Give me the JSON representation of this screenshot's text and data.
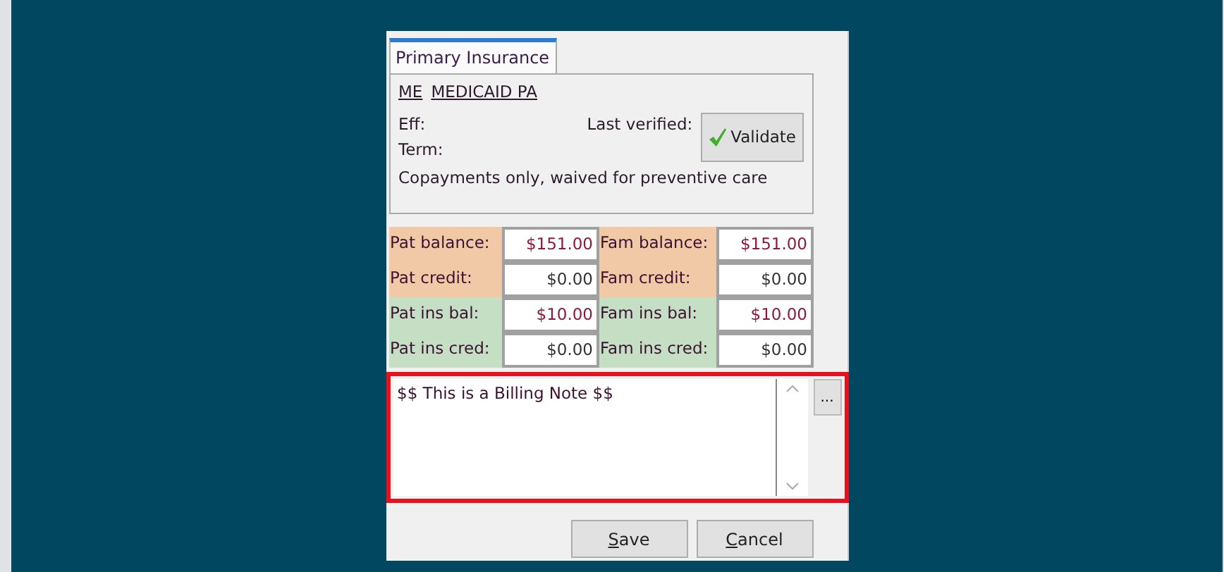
{
  "tab": {
    "label": "Primary Insurance",
    "selected": true
  },
  "plan": {
    "code": "ME",
    "name": "MEDICAID PA"
  },
  "eff_label": "Eff:",
  "term_label": "Term:",
  "last_verified_label": "Last verified:",
  "validate_button": "Validate",
  "coverage_note": "Copayments only, waived for preventive care",
  "balances": [
    {
      "label": "Pat balance:",
      "value": "$151.00",
      "color": "#8b1a3a",
      "kind": "account"
    },
    {
      "label": "Fam balance:",
      "value": "$151.00",
      "color": "#8b1a3a",
      "kind": "account"
    },
    {
      "label": "Pat credit:",
      "value": "$0.00",
      "color": "#333333",
      "kind": "account"
    },
    {
      "label": "Fam credit:",
      "value": "$0.00",
      "color": "#333333",
      "kind": "account"
    },
    {
      "label": "Pat ins bal:",
      "value": "$10.00",
      "color": "#8b1a3a",
      "kind": "insurance"
    },
    {
      "label": "Fam ins bal:",
      "value": "$10.00",
      "color": "#8b1a3a",
      "kind": "insurance"
    },
    {
      "label": "Pat ins cred:",
      "value": "$0.00",
      "color": "#333333",
      "kind": "insurance"
    },
    {
      "label": "Fam ins cred:",
      "value": "$0.00",
      "color": "#333333",
      "kind": "insurance"
    }
  ],
  "billing_note": {
    "value": "$$ This is a Billing Note $$",
    "highlighted": true
  },
  "more_button": "...",
  "buttons": [
    {
      "mnemonic": "S",
      "rest": "ave"
    },
    {
      "mnemonic": "C",
      "rest": "ancel"
    }
  ]
}
